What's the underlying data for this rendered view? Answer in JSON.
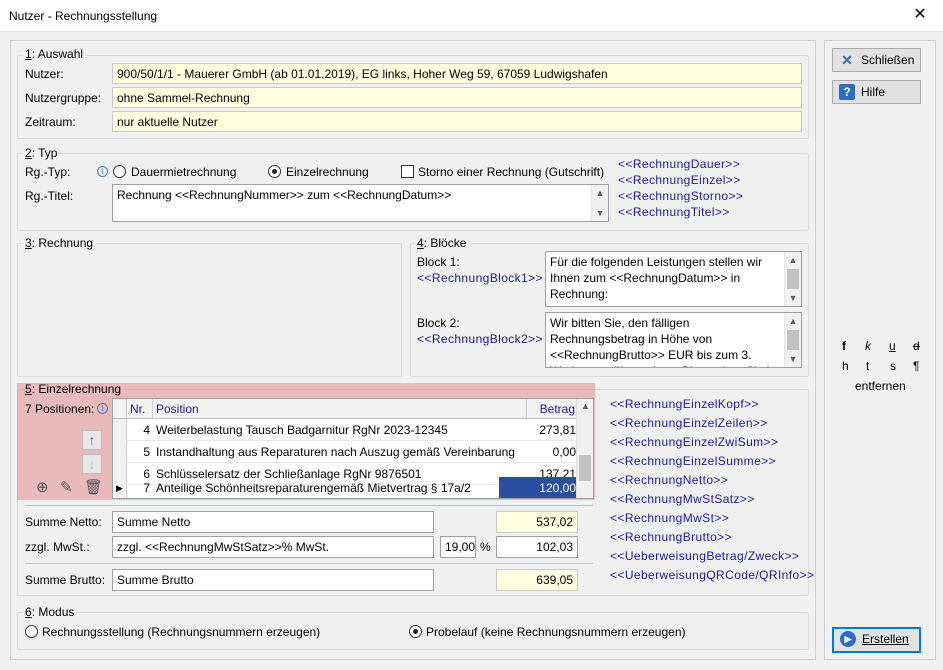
{
  "window": {
    "title": "Nutzer - Rechnungsstellung",
    "close_glyph": "✕"
  },
  "auswahl": {
    "group_label_num": "1",
    "group_label": ": Auswahl",
    "nutzer_label": "Nutzer:",
    "nutzer_value": "900/50/1/1 - Mauerer GmbH  (ab 01.01.2019), EG links, Hoher Weg 59, 67059 Ludwigshafen",
    "gruppe_label": "Nutzergruppe:",
    "gruppe_value": "ohne Sammel-Rechnung",
    "zeitraum_label": "Zeitraum:",
    "zeitraum_value": "nur aktuelle Nutzer"
  },
  "typ": {
    "group_label_num": "2",
    "group_label": ": Typ",
    "rgtyp_label": "Rg.-Typ:",
    "opt_dauer": "Dauermietrechnung",
    "opt_einzel": "Einzelrechnung",
    "opt_storno": "Storno einer Rechnung (Gutschrift)",
    "selected": "Einzelrechnung",
    "storno_checked": false,
    "rgtitel_label": "Rg.-Titel:",
    "rgtitel_value": "Rechnung <<RechnungNummer>> zum <<RechnungDatum>>",
    "placeholders": [
      "<<RechnungDauer>>",
      "<<RechnungEinzel>>",
      "<<RechnungStorno>>",
      "<<RechnungTitel>>"
    ]
  },
  "rechnung": {
    "group_label_num": "3",
    "group_label": ": Rechnung"
  },
  "bloecke": {
    "group_label_num": "4",
    "group_label": ": Blöcke",
    "block1_label": "Block 1:",
    "block1_ph": "<<RechnungBlock1>>",
    "block1_text": "Für die folgenden Leistungen stellen wir Ihnen zum <<RechnungDatum>> in Rechnung:",
    "block2_label": "Block 2:",
    "block2_ph": "<<RechnungBlock2>>",
    "block2_text": "Wir bitten Sie, den fälligen Rechnungsbetrag in Höhe von <<RechnungBrutto>> EUR bis zum 3. Werktag zu überweisen. Bitte geben Sie im Verwendungszweck"
  },
  "einzel": {
    "group_label_num": "5",
    "group_label": ": Einzelrechnung",
    "count_label": "7 Positionen:",
    "columns": {
      "nr": "Nr.",
      "position": "Position",
      "betrag": "Betrag"
    },
    "rows": [
      {
        "nr": "4",
        "position": "Weiterbelastung Tausch Badgarnitur RgNr 2023-12345",
        "betrag": "273,81"
      },
      {
        "nr": "5",
        "position": "Instandhaltung aus Reparaturen nach Auszug gemäß Vereinbarung",
        "betrag": "0,00"
      },
      {
        "nr": "6",
        "position": "Schlüsselersatz der Schließanlage RgNr 9876501",
        "betrag": "137,21"
      },
      {
        "nr": "7",
        "position": "Anteilige Schönheitsreparaturengemäß Mietvertrag § 17a/2",
        "betrag": "120,00"
      }
    ],
    "current_row_marker": "▶",
    "placeholders": [
      "<<RechnungEinzelKopf>>",
      "<<RechnungEinzelZeilen>>",
      "<<RechnungEinzelZwiSum>>",
      "<<RechnungEinzelSumme>>",
      "<<RechnungNetto>>",
      "<<RechnungMwStSatz>>",
      "<<RechnungMwSt>>",
      "<<RechnungBrutto>>",
      "<<UeberweisungBetrag/Zweck>>",
      "<<UeberweisungQRCode/QRInfo>>"
    ]
  },
  "summen": {
    "netto_label": "Summe Netto:",
    "netto_text": "Summe Netto",
    "netto_value": "537,02",
    "mwst_label": "zzgl. MwSt.:",
    "mwst_text": "zzgl. <<RechnungMwStSatz>>% MwSt.",
    "mwst_satz": "19,00",
    "percent": "%",
    "mwst_value": "102,03",
    "brutto_label": "Summe Brutto:",
    "brutto_text": "Summe Brutto",
    "brutto_value": "639,05"
  },
  "modus": {
    "group_label_num": "6",
    "group_label": ": Modus",
    "opt_rechnung": "Rechnungsstellung (Rechnungsnummern erzeugen)",
    "opt_probe": "Probelauf (keine Rechnungsnummern erzeugen)",
    "selected": "Probelauf"
  },
  "buttons": {
    "schliessen": "Schließen",
    "hilfe": "Hilfe",
    "erstellen": "Erstellen"
  },
  "format": {
    "bold": "f",
    "italic": "k",
    "underline": "u",
    "strike": "d",
    "sup": "h",
    "sub": "t",
    "small": "s",
    "para": "¶",
    "remove": "entfernen"
  }
}
